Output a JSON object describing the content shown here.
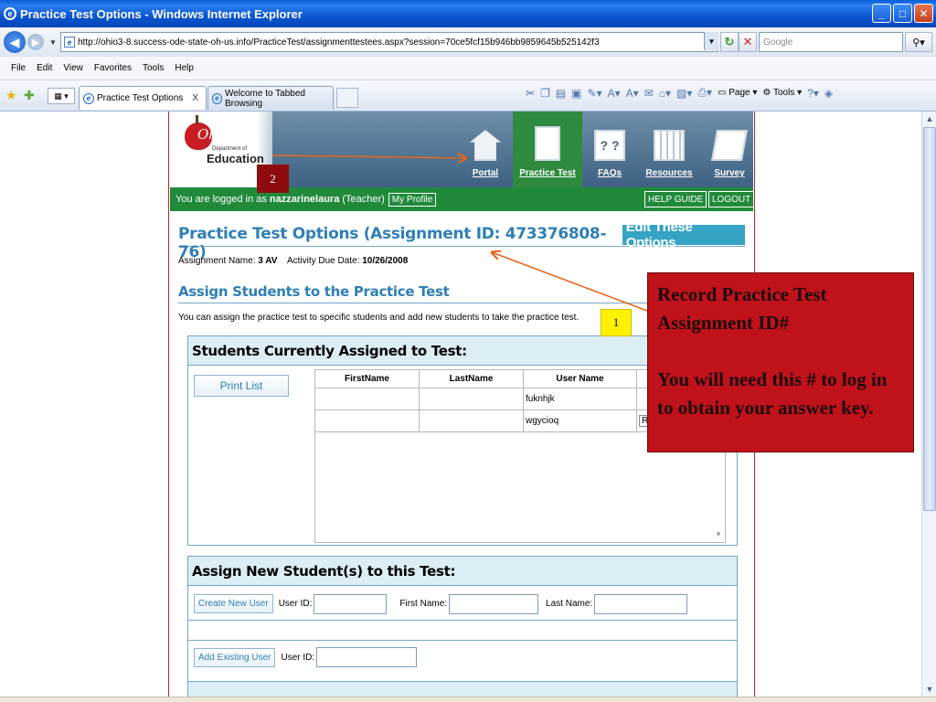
{
  "window": {
    "title": "Practice Test Options - Windows Internet Explorer"
  },
  "address": {
    "url": "http://ohio3-8.success-ode-state-oh-us.info/PracticeTest/assignmenttestees.aspx?session=70ce5fcf15b946bb9859645b525142f3",
    "search_placeholder": "Google"
  },
  "menu": [
    "File",
    "Edit",
    "View",
    "Favorites",
    "Tools",
    "Help"
  ],
  "tabs": [
    {
      "label": "Practice Test Options",
      "active": true
    },
    {
      "label": "Welcome to Tabbed Browsing",
      "active": false
    }
  ],
  "commandbar": {
    "page": "Page",
    "tools": "Tools"
  },
  "site": {
    "logo_dept": "Department of",
    "logo_name": "Education",
    "logo_script": "Ohio",
    "nav": [
      {
        "label": "Portal",
        "icon": "house-icon"
      },
      {
        "label": "Practice Test",
        "icon": "document-icon",
        "active": true
      },
      {
        "label": "FAQs",
        "icon": "faq-icon"
      },
      {
        "label": "Resources",
        "icon": "books-icon"
      },
      {
        "label": "Survey",
        "icon": "clipboard-pen-icon"
      }
    ],
    "logged_in_prefix": "You are logged in as",
    "username": "nazzarinelaura",
    "role": "(Teacher)",
    "my_profile": "My Profile",
    "help_guide": "HELP GUIDE",
    "logout": "LOGOUT"
  },
  "main": {
    "title": "Practice Test Options (Assignment ID: 473376808-76)",
    "edit_button": "Edit These Options",
    "assignment_name_label": "Assignment Name:",
    "assignment_name": "3 AV",
    "activity_due_label": "Activity Due Date:",
    "activity_due": "10/26/2008",
    "assign_heading": "Assign Students to the Practice Test",
    "assign_desc": "You can assign the practice test to specific students and add new students to take the practice test."
  },
  "assigned": {
    "heading": "Students Currently Assigned to Test:",
    "print_button": "Print List",
    "columns": [
      "FirstName",
      "LastName",
      "User Name",
      ""
    ],
    "rows": [
      {
        "first": "",
        "last": "",
        "user": "fuknhjk",
        "action": ""
      },
      {
        "first": "",
        "last": "",
        "user": "wgycioq",
        "action": "R"
      }
    ]
  },
  "new_student": {
    "heading": "Assign New Student(s) to this Test:",
    "create_button": "Create New User",
    "user_id_label": "User ID:",
    "first_name_label": "First Name:",
    "last_name_label": "Last Name:",
    "add_existing_button": "Add Existing User"
  },
  "annotations": {
    "callout_line1": "Record Practice Test Assignment ID#",
    "callout_line2": "You will need this # to log in to obtain your answer key.",
    "badge1": "1",
    "badge2": "2",
    "callout_color": "#c0121b",
    "badge1_color": "#fff200",
    "badge2_color": "#8e0c10"
  }
}
